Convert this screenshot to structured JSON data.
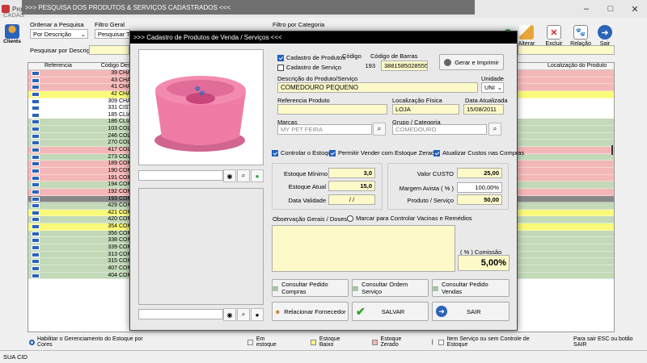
{
  "window": {
    "title": "Pro",
    "inner_title": ">>> PESQUISA DOS PRODUTOS & SERVIÇOS CADASTRADOS  <<<",
    "sub": "CADAS"
  },
  "left_tool": {
    "label": "Clients"
  },
  "filters": {
    "order_label": "Ordenar a Pesquisa",
    "order_value": "Por Descrição",
    "general_label": "Filtro Geral",
    "general_value": "Pesquisar TOD",
    "category_label": "Filtro por Categoria",
    "search_label": "Pesquisar por Descrição"
  },
  "toolbar": {
    "alterar": "Alterar",
    "excluir": "Excluir",
    "relacao": "Relação",
    "sair": "Sair"
  },
  "grid": {
    "headers": [
      "Referencia",
      "Código",
      "Desc",
      "Localização do Produto"
    ],
    "rows": [
      {
        "code": "39",
        "desc": "CHAM",
        "color": "#f4b7b7"
      },
      {
        "code": "43",
        "desc": "CHAM",
        "color": "#f4b7b7"
      },
      {
        "code": "41",
        "desc": "CHAM",
        "color": "#f4b7b7"
      },
      {
        "code": "42",
        "desc": "CHAM",
        "color": "#fafa7a"
      },
      {
        "code": "309",
        "desc": "CHAM",
        "color": "#ffffff"
      },
      {
        "code": "331",
        "desc": "CIST",
        "color": "#ffffff"
      },
      {
        "code": "185",
        "desc": "CLIA",
        "color": "#ffffff"
      },
      {
        "code": "186",
        "desc": "CLIA",
        "color": "#c3d9b8"
      },
      {
        "code": "103",
        "desc": "COLE",
        "color": "#c3d9b8"
      },
      {
        "code": "246",
        "desc": "COLE",
        "color": "#c3d9b8"
      },
      {
        "code": "270",
        "desc": "COLE",
        "color": "#c3d9b8"
      },
      {
        "code": "417",
        "desc": "COLE",
        "color": "#f4b7b7"
      },
      {
        "code": "273",
        "desc": "COLE",
        "color": "#c3d9b8"
      },
      {
        "code": "189",
        "desc": "COM",
        "color": "#f4b7b7"
      },
      {
        "code": "190",
        "desc": "COM",
        "color": "#f4b7b7"
      },
      {
        "code": "191",
        "desc": "COM",
        "color": "#f4b7b7"
      },
      {
        "code": "194",
        "desc": "COM",
        "color": "#c3d9b8"
      },
      {
        "code": "192",
        "desc": "COM",
        "color": "#f4b7b7"
      },
      {
        "code": "193",
        "desc": "COM",
        "color": "#888888"
      },
      {
        "code": "429",
        "desc": "COM",
        "color": "#c3d9b8"
      },
      {
        "code": "421",
        "desc": "COM",
        "color": "#fafa7a"
      },
      {
        "code": "420",
        "desc": "COM",
        "color": "#c3d9b8"
      },
      {
        "code": "354",
        "desc": "COM",
        "color": "#fafa7a"
      },
      {
        "code": "356",
        "desc": "COM",
        "color": "#c3d9b8"
      },
      {
        "code": "338",
        "desc": "COM",
        "color": "#c3d9b8"
      },
      {
        "code": "339",
        "desc": "COM",
        "color": "#c3d9b8"
      },
      {
        "code": "313",
        "desc": "COM",
        "color": "#c3d9b8"
      },
      {
        "code": "315",
        "desc": "COM",
        "color": "#c3d9b8"
      },
      {
        "code": "407",
        "desc": "COM",
        "color": "#c3d9b8"
      },
      {
        "code": "404",
        "desc": "COM",
        "color": "#c3d9b8"
      }
    ]
  },
  "legend": {
    "habilitar": "Habilitar o Gerenciamento do Estoque por Cores",
    "em_estoque": "Em estoque",
    "estoque_baixo": "Estoque Baixo",
    "estoque_zerado": "Estoque Zerado",
    "separator": "|",
    "item_servico": "Item Serviço ou sem Controle de Estoque",
    "hint": "Para sair ESC ou botão SAIR"
  },
  "status": {
    "left": "SUA CID"
  },
  "dialog": {
    "title": ">>>  Cadastro de Produtos de Venda / Serviços  <<<",
    "chk_produtos": "Cadastro de Produtos",
    "chk_servico": "Cadastro de Serviço",
    "codigo_label": "Código",
    "codigo": "193",
    "barras_label": "Código de Barras",
    "barras": "3881585028555",
    "gerar": "Gerar e Imprimir",
    "desc_label": "Descrição do Produto/Serviço",
    "desc": "COMEDOURO PEQUENO",
    "unidade_label": "Unidade",
    "unidade": "UNI",
    "ref_label": "Referencia Produto",
    "ref": "",
    "loc_label": "Localização Física",
    "loc": "LOJA",
    "data_label": "Data Atualizada",
    "data": "15/08/2011",
    "marcas_label": "Marcas",
    "marcas": "MY PET FEIRA",
    "grupo_label": "Grupo / Categoria",
    "grupo": "COMEDOURO",
    "ctrl_estoque": "Controlar o Estoque",
    "permitir": "Permitir Vender com Estoque Zerado",
    "atualizar": "Atualizar Custos nas Compras",
    "est_min_label": "Estoque Mínimo",
    "est_min": "3,0",
    "est_atual_label": "Estoque Atual",
    "est_atual": "15,0",
    "validade_label": "Data Validade",
    "validade": "/ /",
    "custo_label": "Valor CUSTO",
    "custo": "25,00",
    "margem_label": "Margem Avista ( % )",
    "margem": "100,00%",
    "preco_label": "Produto / Serviço",
    "preco": "50,00",
    "obs_label": "Observação Gerais / Doses",
    "vacinas": "Marcar para Controlar Vacinas e Remédios",
    "comissao_label": "( % ) Comissão",
    "comissao": "5,00%",
    "btn_compras": "Consultar Pedido Compras",
    "btn_ordem": "Consultar Ordem Serviço",
    "btn_vendas": "Consultar Pedido Vendas",
    "btn_fornecedor": "Relacionar Fornecedor",
    "btn_salvar": "SALVAR",
    "btn_sair": "SAIR"
  }
}
